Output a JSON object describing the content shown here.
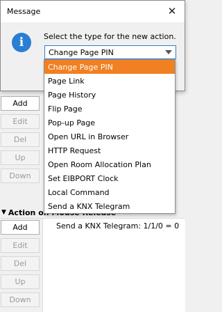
{
  "background": {
    "buttons_upper": [
      {
        "label": "Add",
        "active": true
      },
      {
        "label": "Edit",
        "active": false
      },
      {
        "label": "Del",
        "active": false
      },
      {
        "label": "Up",
        "active": false
      },
      {
        "label": "Down",
        "active": false
      }
    ],
    "section_header": {
      "triangle": "▼",
      "label": "Action on Mouse Release"
    },
    "buttons_lower": [
      {
        "label": "Add",
        "active": true
      },
      {
        "label": "Edit",
        "active": false
      },
      {
        "label": "Del",
        "active": false
      },
      {
        "label": "Up",
        "active": false
      },
      {
        "label": "Down",
        "active": false
      }
    ],
    "action_items": [
      "Send a KNX Telegram: 1/1/0 = 0"
    ]
  },
  "dialog": {
    "title": "Message",
    "close_glyph": "✕",
    "icon_glyph": "i",
    "prompt": "Select the type for the new action.",
    "selected_value": "Change Page PIN",
    "options": [
      "Change Page PIN",
      "Page Link",
      "Page History",
      "Flip Page",
      "Pop-up Page",
      "Open URL in Browser",
      "HTTP Request",
      "Open Room Allocation Plan",
      "Set EIBPORT Clock",
      "Local Command",
      "Send a KNX Telegram"
    ],
    "highlighted_index": 0
  },
  "colors": {
    "accent": "#2a7ed3",
    "highlight": "#f08021"
  },
  "icons": {
    "info": "info-icon",
    "close": "close-icon",
    "dropdown": "chevron-down-icon",
    "collapse": "triangle-down-icon"
  }
}
